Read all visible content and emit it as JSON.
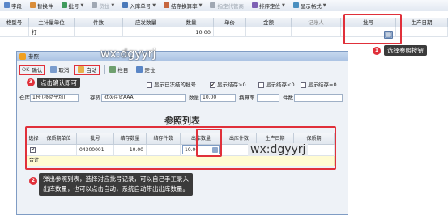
{
  "toolbar": {
    "items": [
      {
        "label": "字段",
        "disabled": false,
        "has_arrow": false
      },
      {
        "label": "替换件",
        "disabled": false,
        "has_arrow": false
      },
      {
        "label": "批号",
        "disabled": false,
        "has_arrow": true
      },
      {
        "label": "货位",
        "disabled": true,
        "has_arrow": true
      },
      {
        "label": "入库单号",
        "disabled": false,
        "has_arrow": true
      },
      {
        "label": "结存换算率",
        "disabled": false,
        "has_arrow": true
      },
      {
        "label": "指定代管商",
        "disabled": true,
        "has_arrow": false
      },
      {
        "label": "排序定位",
        "disabled": false,
        "has_arrow": true
      },
      {
        "label": "显示格式",
        "disabled": false,
        "has_arrow": true
      }
    ]
  },
  "main_grid": {
    "headers": [
      "格型号",
      "主计量单位",
      "件数",
      "应发数量",
      "数量",
      "单价",
      "金额",
      "记账人",
      "批号",
      "生产日期"
    ],
    "row": {
      "unit": "打",
      "quantity": "10.00"
    }
  },
  "dialog": {
    "title": "参照",
    "buttons": {
      "ok_key": "OK",
      "ok": "确认",
      "cancel": "取消",
      "auto": "自动",
      "column": "栏目",
      "locate": "定位"
    },
    "checkboxes": {
      "show_expired": "显示已冻结的批号",
      "show_stock_gt0": "显示结存>0",
      "show_stock_lt0": "显示结存<0",
      "show_stock_eq0": "显示结存=0"
    },
    "fields": {
      "warehouse_label": "仓库",
      "warehouse_value": "1仓 (移动平均)",
      "inventory_label": "存货",
      "inventory_value": "批次存货AAA",
      "quantity_label": "数量",
      "quantity_value": "10.00",
      "rate_label": "换算率",
      "pieces_label": "件数"
    },
    "ref_list_title": "参照列表",
    "table": {
      "headers": [
        "选择",
        "保质期单位",
        "批号",
        "结存数量",
        "结存件数",
        "出库数量",
        "出库件数",
        "生产日期",
        "保质期"
      ],
      "row": {
        "checked": "✔",
        "batch": "04300001",
        "stock_qty": "10.00",
        "out_qty": "10.00"
      },
      "total_label": "合计"
    }
  },
  "annotations": {
    "watermark": "wx:dgyyrj",
    "tip1": "选择参照按钮",
    "tip3": "点击确认即可",
    "tip2_line1": "弹出参照列表，选择对应批号记录，可以自己手工录入",
    "tip2_line2": "出库数量，也可以点击自动，系统自动带出出库数量。",
    "badges": [
      "1",
      "2",
      "3"
    ]
  },
  "colors": {
    "highlight": "#e0303a",
    "tip_bg": "#3b3b3b",
    "total_row": "#fffbd2"
  }
}
